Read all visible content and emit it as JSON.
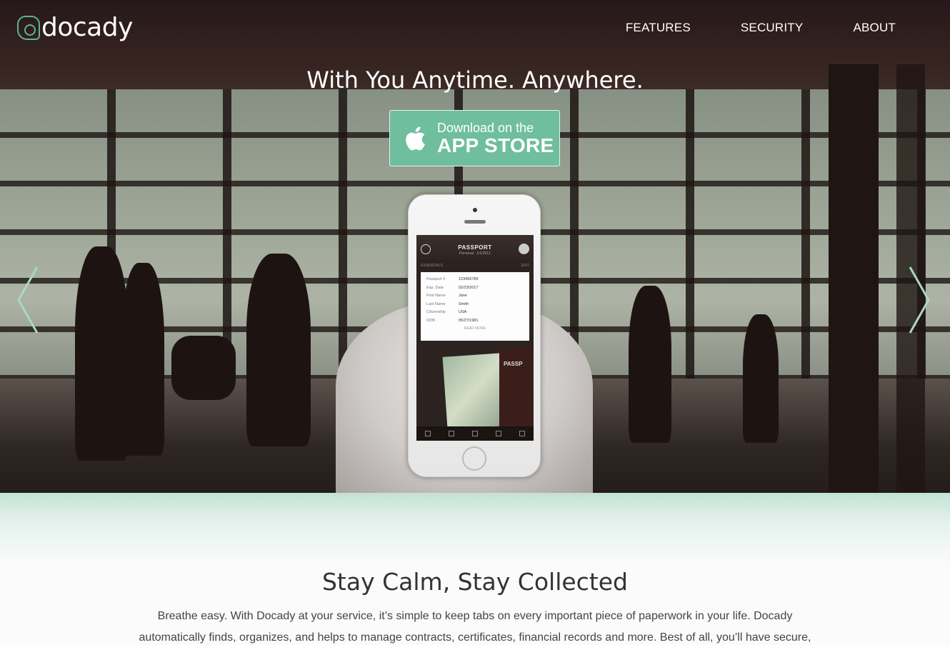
{
  "brand": {
    "name": "docady",
    "accent": "#6fbe9d"
  },
  "nav": {
    "items": [
      "FEATURES",
      "SECURITY",
      "ABOUT"
    ]
  },
  "hero": {
    "headline": "With You Anytime. Anywhere.",
    "cta": {
      "line1": "Download on the",
      "line2": "APP STORE",
      "icon": "apple-icon"
    },
    "prev_icon": "chevron-left-icon",
    "next_icon": "chevron-right-icon"
  },
  "phone_screen": {
    "title": "PASSPORT",
    "subtitle": "Personal · 1/1/2012",
    "tab_left": "ESSENTIALS",
    "tab_right": "EDIT",
    "fields": [
      {
        "k": "Passport #",
        "v": "123456789"
      },
      {
        "k": "Exp. Date",
        "v": "02/23/2017"
      },
      {
        "k": "First Name",
        "v": "Jane"
      },
      {
        "k": "Last Name",
        "v": "Smith"
      },
      {
        "k": "Citizenship",
        "v": "USA"
      },
      {
        "k": "DOB",
        "v": "05/27/1981"
      }
    ],
    "read_more": "READ MORE",
    "book_label": "PASSP"
  },
  "section": {
    "title": "Stay Calm, Stay Collected",
    "body": "Breathe easy. With Docady at your service, it’s simple to keep tabs on every important piece of paperwork in your life. Docady automatically finds, organizes, and helps to manage contracts, certificates, financial records and more. Best of all, you’ll have secure,"
  }
}
